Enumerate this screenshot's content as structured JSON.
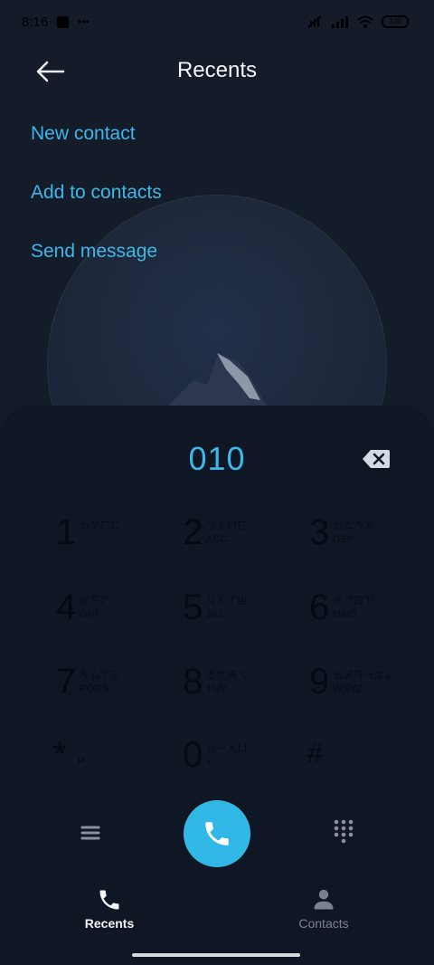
{
  "status_bar": {
    "time": "8:16",
    "battery": "100"
  },
  "header": {
    "title": "Recents"
  },
  "actions": [
    {
      "label": "New contact"
    },
    {
      "label": "Add to contacts"
    },
    {
      "label": "Send message"
    }
  ],
  "dialer": {
    "number": "010",
    "keys": [
      {
        "digit": "1",
        "top": "ㄉㄚㄈㄈ",
        "bot": ""
      },
      {
        "digit": "2",
        "top": "ㄅㄆㄇㄈ",
        "bot": "ABC"
      },
      {
        "digit": "3",
        "top": "ㄉㄊㄋㄌ",
        "bot": "DEF"
      },
      {
        "digit": "4",
        "top": "ㄍㄎㄏ",
        "bot": "GHI"
      },
      {
        "digit": "5",
        "top": "ㄐㄑㄒㄓ",
        "bot": "JKL"
      },
      {
        "digit": "6",
        "top": "ㄔㄕㄖㄗ",
        "bot": "MNO"
      },
      {
        "digit": "7",
        "top": "ㄘㄙㄚㄛ",
        "bot": "PQRS"
      },
      {
        "digit": "8",
        "top": "ㄜㄝㄞㄟ",
        "bot": "TUV"
      },
      {
        "digit": "9",
        "top": "ㄠㄡㄢㄣㄤㄥ",
        "bot": "WXYZ"
      },
      {
        "digit": "*",
        "top": "",
        "bot": "P"
      },
      {
        "digit": "0",
        "top": "ㄦㄧㄨㄩ",
        "bot": "+"
      },
      {
        "digit": "#",
        "top": "",
        "bot": ""
      }
    ]
  },
  "tabs": {
    "recents": "Recents",
    "contacts": "Contacts"
  },
  "colors": {
    "accent": "#3db7e9",
    "background": "#141c2a",
    "dialpad": "#0f1624"
  }
}
